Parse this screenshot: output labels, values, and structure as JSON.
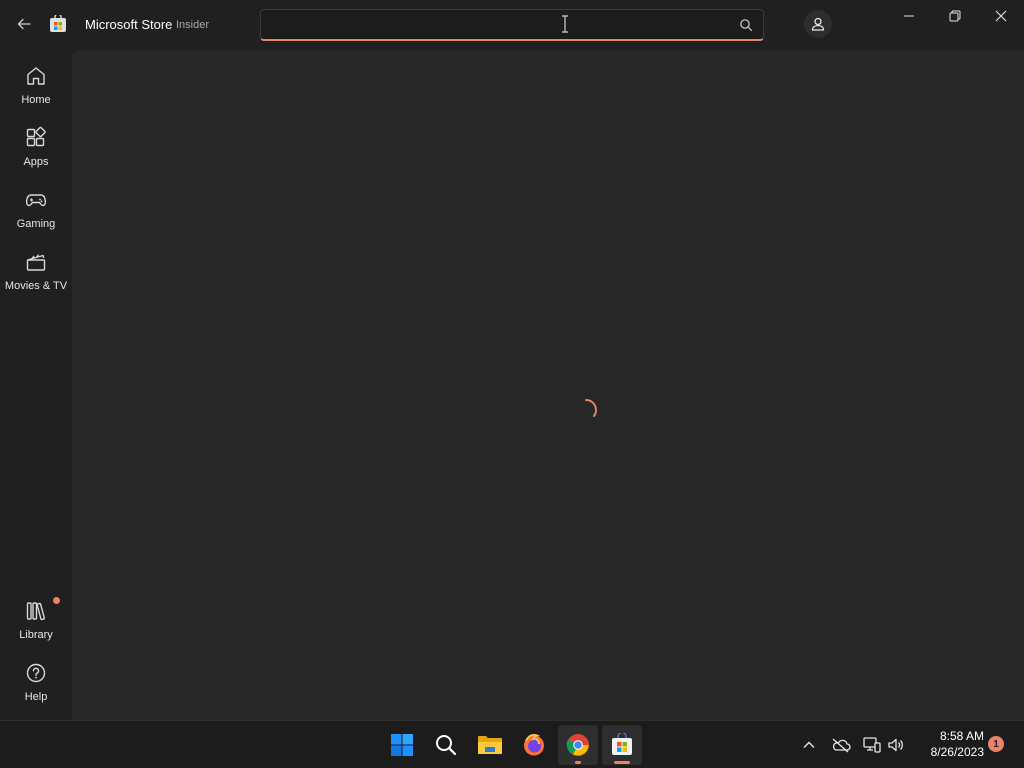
{
  "window": {
    "title": "Microsoft Store",
    "badge": "Insider"
  },
  "search": {
    "value": "",
    "placeholder": ""
  },
  "sidebar": {
    "items": [
      {
        "label": "Home",
        "icon": "home-icon"
      },
      {
        "label": "Apps",
        "icon": "apps-icon"
      },
      {
        "label": "Gaming",
        "icon": "gaming-icon"
      },
      {
        "label": "Movies & TV",
        "icon": "movies-tv-icon"
      }
    ],
    "bottom_items": [
      {
        "label": "Library",
        "icon": "library-icon"
      },
      {
        "label": "Help",
        "icon": "help-icon"
      }
    ]
  },
  "content": {
    "state": "loading"
  },
  "taskbar": {
    "apps": [
      "start",
      "search",
      "file-explorer",
      "firefox",
      "chrome",
      "microsoft-store"
    ],
    "clock_time": "8:58 AM",
    "clock_date": "8/26/2023",
    "notification_count": "1"
  },
  "colors": {
    "accent": "#e8836a",
    "background": "#202020",
    "content_background": "#272727",
    "taskbar": "#1c1c1c"
  }
}
